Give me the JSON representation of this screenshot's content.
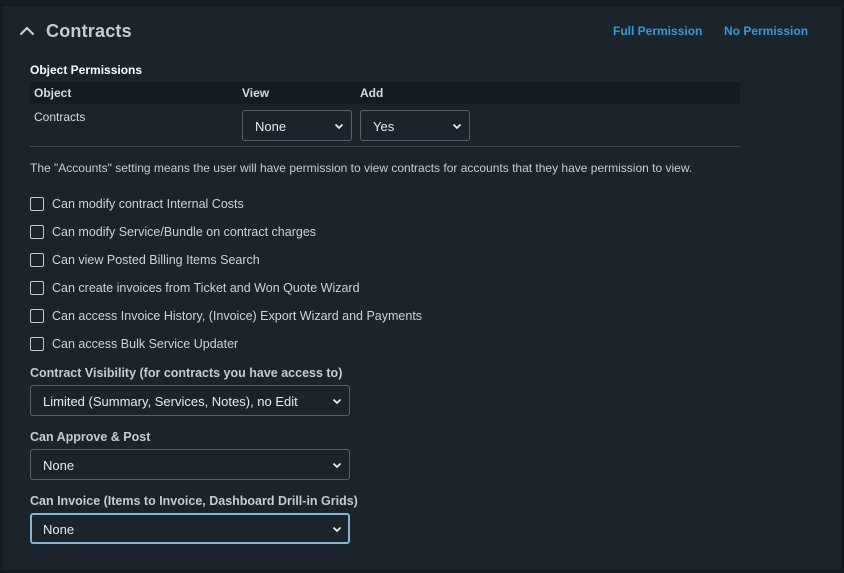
{
  "header": {
    "title": "Contracts",
    "full_permission_link": "Full Permission",
    "no_permission_link": "No Permission"
  },
  "object_permissions": {
    "title": "Object Permissions",
    "columns": [
      "Object",
      "View",
      "Add"
    ],
    "rows": [
      {
        "object": "Contracts",
        "view": "None",
        "add": "Yes"
      }
    ]
  },
  "note": "The \"Accounts\" setting means the user will have permission to view contracts for accounts that they have permission to view.",
  "checkboxes": [
    {
      "label": "Can modify contract Internal Costs",
      "checked": false
    },
    {
      "label": "Can modify Service/Bundle on contract charges",
      "checked": false
    },
    {
      "label": "Can view Posted Billing Items Search",
      "checked": false
    },
    {
      "label": "Can create invoices from Ticket and Won Quote Wizard",
      "checked": false
    },
    {
      "label": "Can access Invoice History, (Invoice) Export Wizard and Payments",
      "checked": false
    },
    {
      "label": "Can access Bulk Service Updater",
      "checked": false
    }
  ],
  "fields": {
    "contract_visibility": {
      "label": "Contract Visibility (for contracts you have access to)",
      "value": "Limited (Summary, Services, Notes), no Edit"
    },
    "approve_post": {
      "label": "Can Approve & Post",
      "value": "None"
    },
    "can_invoice": {
      "label": "Can Invoice (Items to Invoice, Dashboard Drill-in Grids)",
      "value": "None"
    }
  },
  "colors": {
    "background": "#151b21",
    "panel": "#1c242b",
    "link": "#2e9be0",
    "focus_border": "#7fb6d9"
  },
  "icons": {
    "collapse": "chevron-up-icon",
    "select_caret": "chevron-down-icon"
  }
}
